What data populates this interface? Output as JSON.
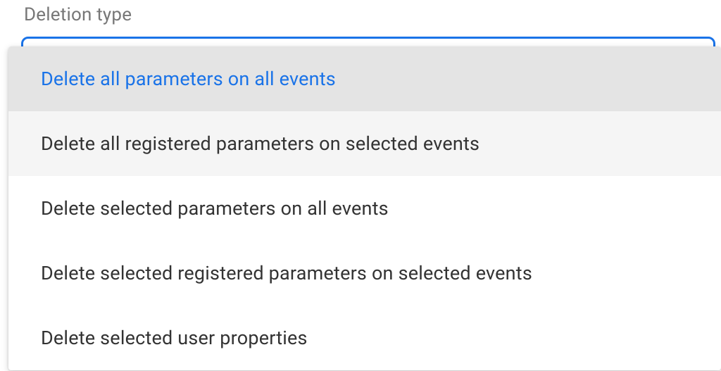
{
  "field": {
    "label": "Deletion type"
  },
  "options": [
    {
      "label": "Delete all parameters on all events"
    },
    {
      "label": "Delete all registered parameters on selected events"
    },
    {
      "label": "Delete selected parameters on all events"
    },
    {
      "label": "Delete selected registered parameters on selected events"
    },
    {
      "label": "Delete selected user properties"
    }
  ]
}
